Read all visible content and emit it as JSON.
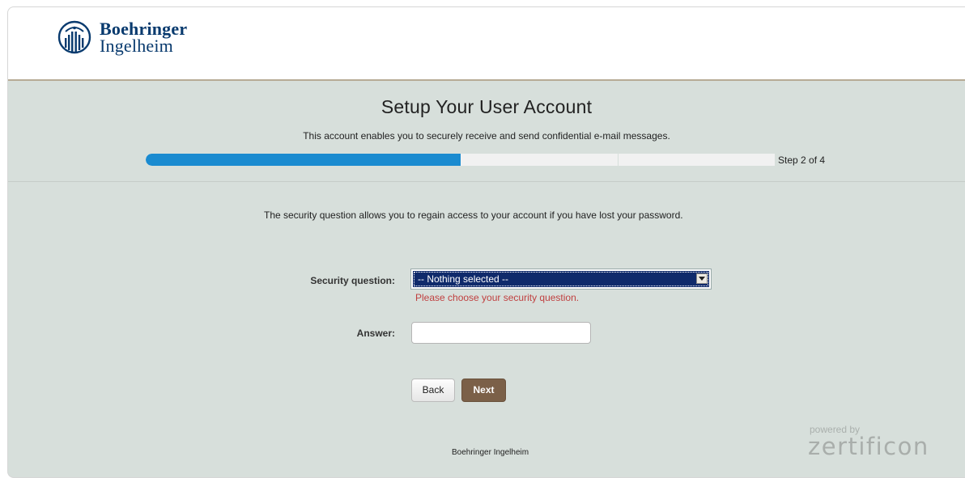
{
  "brand": {
    "line1": "Boehringer",
    "line2": "Ingelheim",
    "color": "#083a6e",
    "logo_icon": "boehringer-building-logo-icon"
  },
  "page": {
    "title": "Setup Your User Account",
    "subtitle": "This account enables you to securely receive and send confidential e-mail messages."
  },
  "progress": {
    "step_label": "Step 2 of 4",
    "current_step": 2,
    "total_steps": 4,
    "fill_fraction": 0.5,
    "color": "#1a8bd0"
  },
  "form": {
    "intro": "The security question allows you to regain access to your account if you have lost your password.",
    "security_question_label": "Security question:",
    "security_question_value": "-- Nothing selected --",
    "security_question_error": "Please choose your security question.",
    "answer_label": "Answer:",
    "answer_value": "",
    "error_color": "#c04040"
  },
  "buttons": {
    "back": "Back",
    "next": "Next",
    "next_color": "#7b6048"
  },
  "footer": {
    "company": "Boehringer Ingelheim",
    "powered_by": "powered by",
    "vendor": "zertificon"
  }
}
